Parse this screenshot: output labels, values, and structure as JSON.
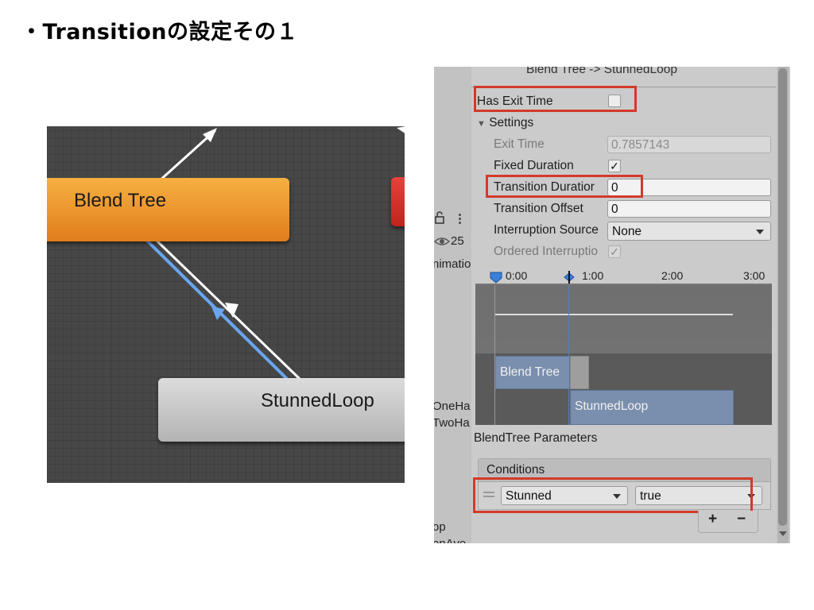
{
  "slide": {
    "title": "・Transitionの設定その１"
  },
  "graph": {
    "blend_tree_label": "Blend Tree",
    "stunned_loop_label": "StunnedLoop",
    "colors": {
      "blend_tree_node": "#f0a030",
      "selected_transition": "#6aa6ef",
      "error_node": "#d83028"
    }
  },
  "inspector": {
    "header": "Blend Tree -> StunnedLoop",
    "left_strip": {
      "count": "25",
      "animation_partial": "nimatio",
      "param_1_partial": "OneHa",
      "param_2_partial": "TwoHa",
      "bottom_1_partial": "op",
      "bottom_2_partial": "onAve"
    },
    "has_exit_time": {
      "label": "Has Exit Time",
      "checked": false
    },
    "settings_label": "Settings",
    "exit_time": {
      "label": "Exit Time",
      "value": "0.7857143"
    },
    "fixed_duration": {
      "label": "Fixed Duration",
      "checked": true
    },
    "transition_duration": {
      "label": "Transition Duratior",
      "value": "0"
    },
    "transition_offset": {
      "label": "Transition Offset",
      "value": "0"
    },
    "interruption_source": {
      "label": "Interruption Source",
      "value": "None"
    },
    "ordered_interruption": {
      "label": "Ordered Interruptio",
      "checked": true
    },
    "timeline": {
      "ticks": [
        "0:00",
        "1:00",
        "2:00",
        "3:00"
      ],
      "bar_1": "Blend Tree",
      "bar_2": "StunnedLoop"
    },
    "blendtree_parameters_label": "BlendTree Parameters",
    "conditions": {
      "header": "Conditions",
      "parameter": "Stunned",
      "value": "true",
      "add_label": "+",
      "remove_label": "−"
    }
  }
}
